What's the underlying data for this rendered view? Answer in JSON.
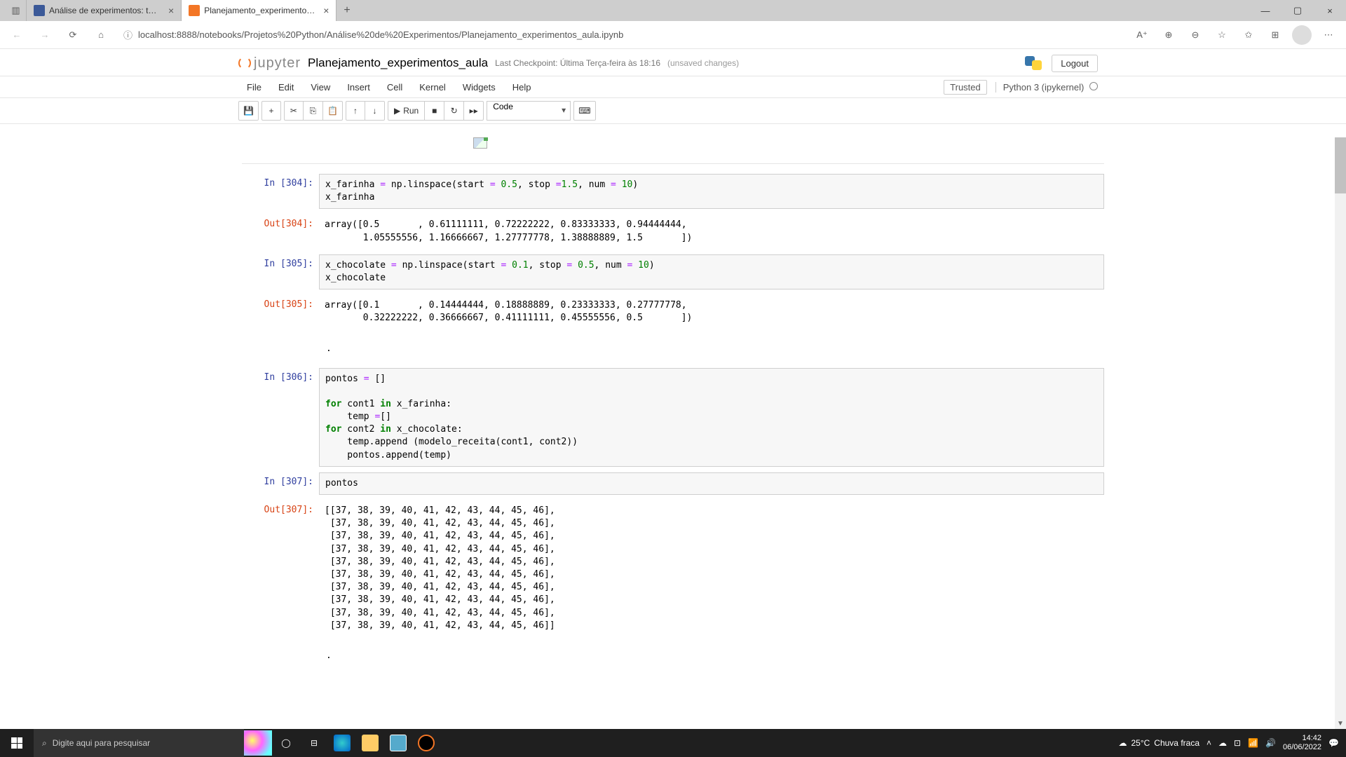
{
  "browser": {
    "tabs": [
      {
        "label": "Análise de experimentos: testes",
        "active": false
      },
      {
        "label": "Planejamento_experimentos_aul",
        "active": true
      }
    ],
    "url": "localhost:8888/notebooks/Projetos%20Python/Análise%20de%20Experimentos/Planejamento_experimentos_aula.ipynb"
  },
  "jupyter": {
    "logo_text": "jupyter",
    "title": "Planejamento_experimentos_aula",
    "checkpoint": "Last Checkpoint: Última Terça-feira às 18:16",
    "autosave": "(unsaved changes)",
    "logout": "Logout",
    "menu": [
      "File",
      "Edit",
      "View",
      "Insert",
      "Cell",
      "Kernel",
      "Widgets",
      "Help"
    ],
    "trusted": "Trusted",
    "kernel": "Python 3 (ipykernel)",
    "toolbar": {
      "run": "Run",
      "celltype": "Code"
    }
  },
  "cells": {
    "c304_in_prompt": "In [304]:",
    "c304_code": "x_farinha = np.linspace(start = 0.5, stop =1.5, num = 10)\nx_farinha",
    "c304_out_prompt": "Out[304]:",
    "c304_out": "array([0.5       , 0.61111111, 0.72222222, 0.83333333, 0.94444444,\n       1.05555556, 1.16666667, 1.27777778, 1.38888889, 1.5       ])",
    "c305_in_prompt": "In [305]:",
    "c305_code": "x_chocolate = np.linspace(start = 0.1, stop = 0.5, num = 10)\nx_chocolate",
    "c305_out_prompt": "Out[305]:",
    "c305_out": "array([0.1       , 0.14444444, 0.18888889, 0.23333333, 0.27777778,\n       0.32222222, 0.36666667, 0.41111111, 0.45555556, 0.5       ])",
    "c306_in_prompt": "In [306]:",
    "c306_code": "pontos = []\n\nfor cont1 in x_farinha:\n    temp =[]\nfor cont2 in x_chocolate:\n    temp.append (modelo_receita(cont1, cont2))\n    pontos.append(temp)",
    "c307_in_prompt": "In [307]:",
    "c307_code": "pontos",
    "c307_out_prompt": "Out[307]:",
    "c307_out": "[[37, 38, 39, 40, 41, 42, 43, 44, 45, 46],\n [37, 38, 39, 40, 41, 42, 43, 44, 45, 46],\n [37, 38, 39, 40, 41, 42, 43, 44, 45, 46],\n [37, 38, 39, 40, 41, 42, 43, 44, 45, 46],\n [37, 38, 39, 40, 41, 42, 43, 44, 45, 46],\n [37, 38, 39, 40, 41, 42, 43, 44, 45, 46],\n [37, 38, 39, 40, 41, 42, 43, 44, 45, 46],\n [37, 38, 39, 40, 41, 42, 43, 44, 45, 46],\n [37, 38, 39, 40, 41, 42, 43, 44, 45, 46],\n [37, 38, 39, 40, 41, 42, 43, 44, 45, 46]]"
  },
  "taskbar": {
    "search_placeholder": "Digite aqui para pesquisar",
    "weather_temp": "25°C",
    "weather_desc": "Chuva fraca",
    "time": "14:42",
    "date": "06/06/2022"
  }
}
